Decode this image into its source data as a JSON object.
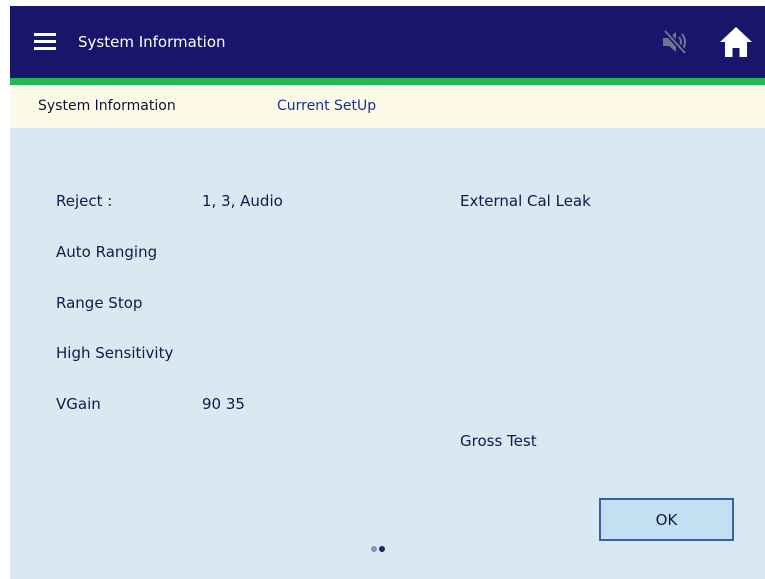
{
  "header": {
    "title": "System Information",
    "icons": {
      "menu": "hamburger-menu-icon",
      "mute": "speaker-muted-icon",
      "home": "home-icon"
    },
    "colors": {
      "bar": "#17166a",
      "accent": "#22b85a"
    }
  },
  "tabs": [
    {
      "label": "System Information"
    },
    {
      "label": "Current SetUp"
    }
  ],
  "info": {
    "reject_label": "Reject :",
    "reject_value": "1, 3, Audio",
    "auto_ranging": "Auto Ranging",
    "range_stop": "Range Stop",
    "high_sensitivity": "High Sensitivity",
    "vgain_label": "VGain",
    "vgain_value": "90 35",
    "external_cal_leak": "External Cal Leak",
    "gross_test": "Gross Test"
  },
  "footer": {
    "ok_label": "OK",
    "page_count": 2,
    "active_page": 2
  }
}
